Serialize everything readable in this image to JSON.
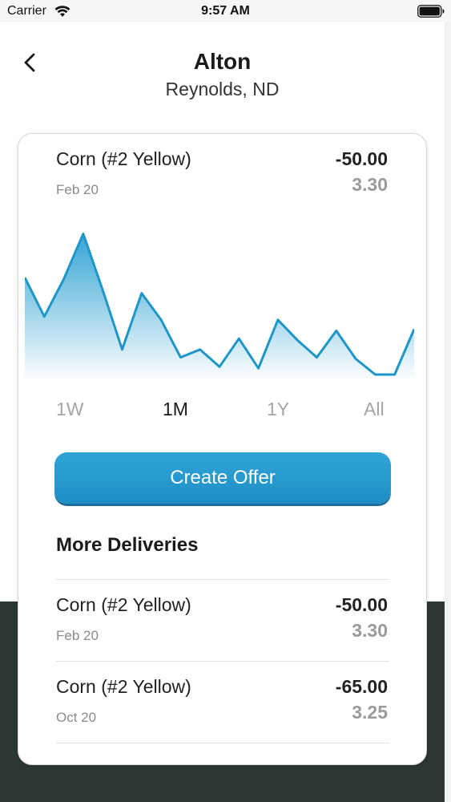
{
  "status_bar": {
    "carrier": "Carrier",
    "time": "9:57 AM"
  },
  "header": {
    "title": "Alton",
    "subtitle": "Reynolds, ND"
  },
  "featured": {
    "name": "Corn (#2 Yellow)",
    "date": "Feb 20",
    "price": "-50.00",
    "change": "3.30"
  },
  "chart_data": {
    "type": "area",
    "x": [
      0,
      1,
      2,
      3,
      4,
      5,
      6,
      7,
      8,
      9,
      10,
      11,
      12,
      13,
      14,
      15,
      16,
      17,
      18,
      19,
      20
    ],
    "values": [
      62,
      37,
      61,
      90,
      54,
      16,
      52,
      35,
      11,
      16,
      5,
      23,
      4,
      35,
      22,
      11,
      28,
      10,
      0,
      0,
      29
    ],
    "ylim": [
      0,
      100
    ],
    "line_color": "#1e96c8",
    "fill_top_color": "#2aa0d2",
    "grid": false
  },
  "range_tabs": [
    {
      "label": "1W",
      "active": false
    },
    {
      "label": "1M",
      "active": true
    },
    {
      "label": "1Y",
      "active": false
    },
    {
      "label": "All",
      "active": false
    }
  ],
  "actions": {
    "create_offer_label": "Create Offer"
  },
  "more_deliveries": {
    "title": "More Deliveries",
    "items": [
      {
        "name": "Corn (#2 Yellow)",
        "date": "Feb 20",
        "price": "-50.00",
        "change": "3.30"
      },
      {
        "name": "Corn (#2 Yellow)",
        "date": "Oct 20",
        "price": "-65.00",
        "change": "3.25"
      }
    ]
  },
  "icons": {
    "back": "chevron-left-icon",
    "wifi": "wifi-icon",
    "battery": "battery-icon"
  },
  "colors": {
    "accent": "#1e96c8",
    "dark_background": "#2c3634"
  }
}
